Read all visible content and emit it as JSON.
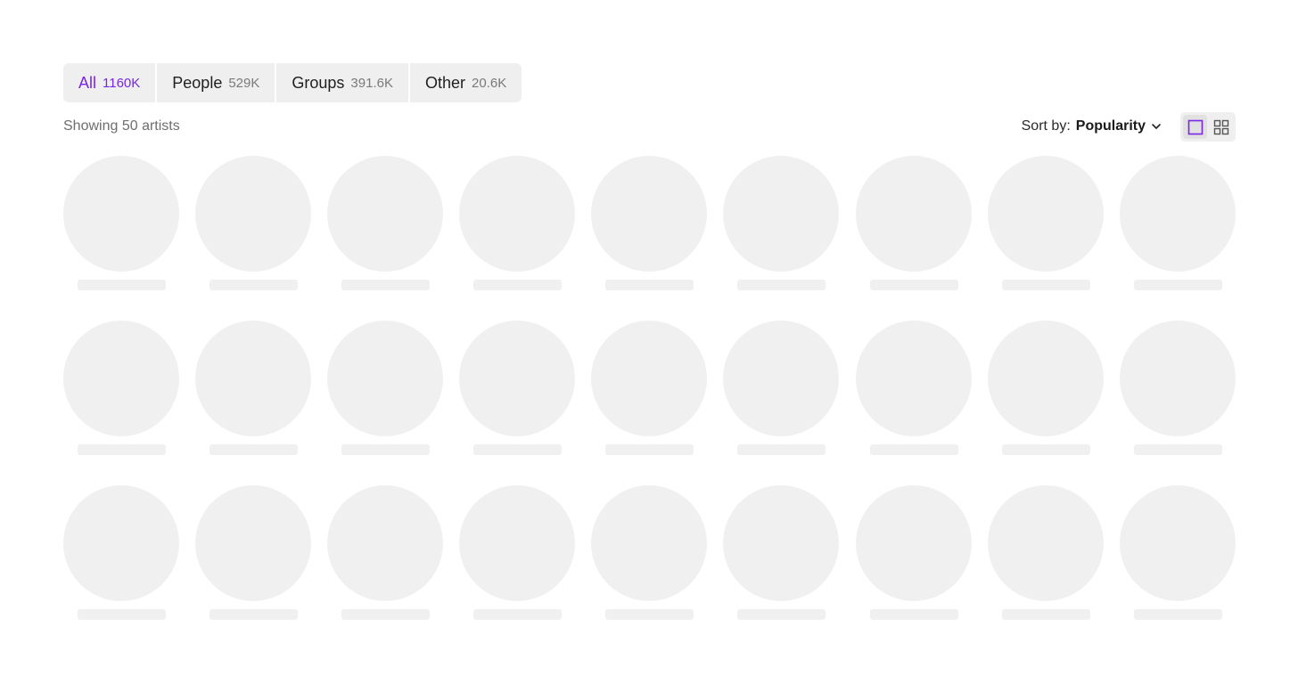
{
  "filters": {
    "tabs": [
      {
        "label": "All",
        "count": "1160K",
        "active": true
      },
      {
        "label": "People",
        "count": "529K",
        "active": false
      },
      {
        "label": "Groups",
        "count": "391.6K",
        "active": false
      },
      {
        "label": "Other",
        "count": "20.6K",
        "active": false
      }
    ]
  },
  "toolbar": {
    "showing_text": "Showing 50 artists",
    "sort_label": "Sort by:",
    "sort_value": "Popularity",
    "sort_icon": "chevron-down-icon",
    "view_modes": [
      {
        "name": "single-view",
        "icon": "square-icon",
        "active": true
      },
      {
        "name": "grid-view",
        "icon": "grid-icon",
        "active": false
      }
    ]
  },
  "colors": {
    "accent": "#7a26e6",
    "skeleton": "#f0f0f0",
    "tab_bg": "#efefef"
  },
  "grid": {
    "rows": 3,
    "columns": 9,
    "loading": true
  }
}
